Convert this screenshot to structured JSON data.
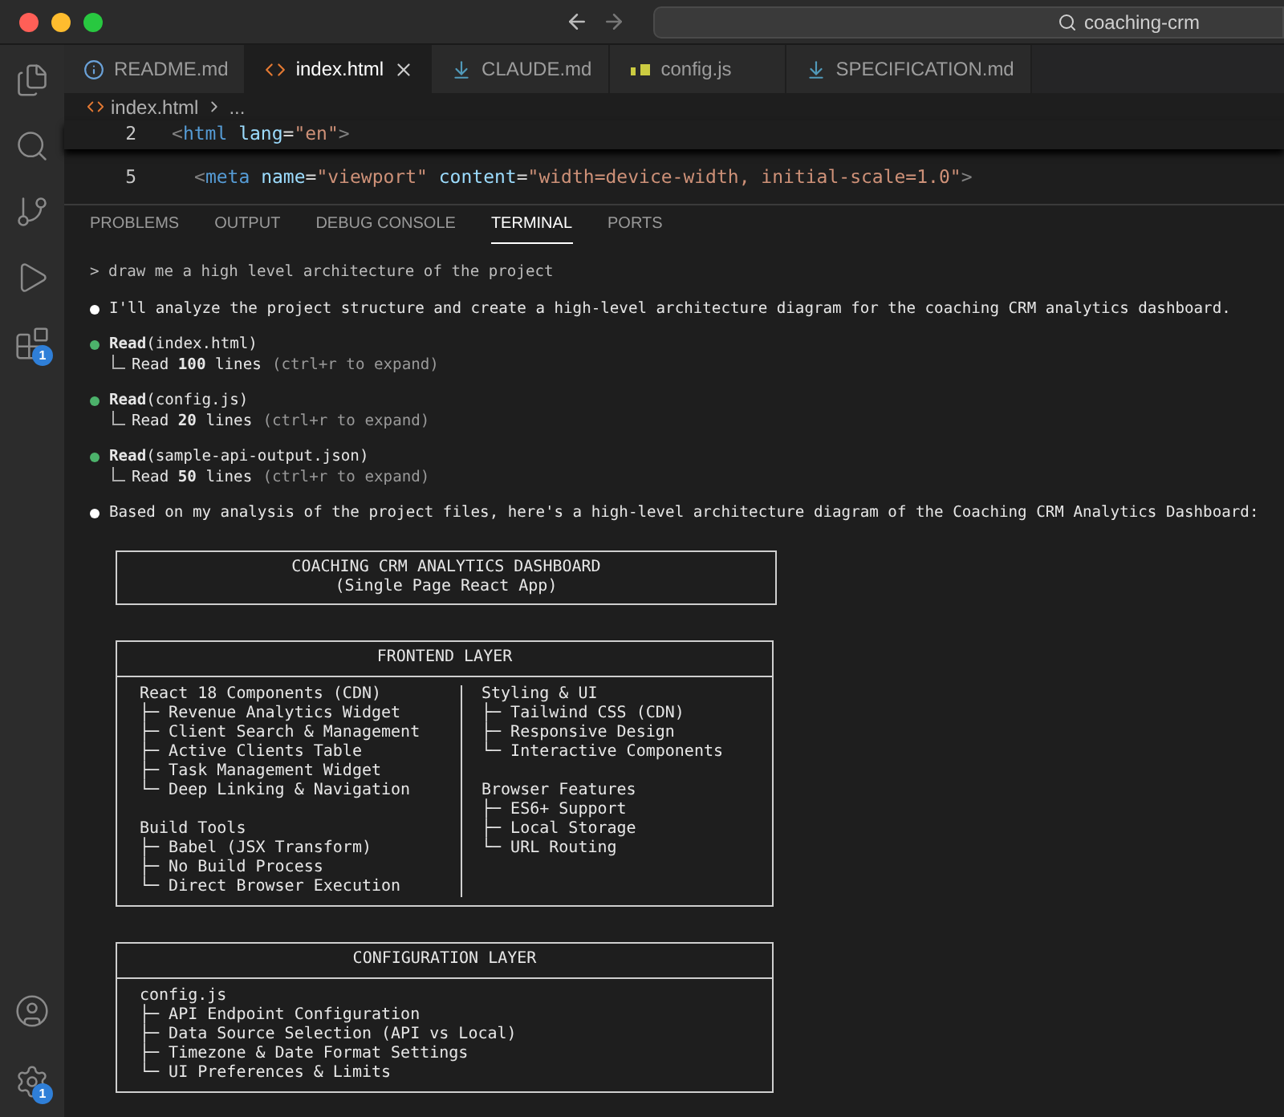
{
  "window": {
    "search": "coaching-crm"
  },
  "activity_bar": [
    {
      "kind": "files"
    },
    {
      "kind": "search"
    },
    {
      "kind": "source-control"
    },
    {
      "kind": "run-debug"
    },
    {
      "kind": "extensions",
      "badge": "1"
    }
  ],
  "activity_bar_bottom": [
    {
      "kind": "account"
    },
    {
      "kind": "settings",
      "badge": "1"
    }
  ],
  "tabs": [
    {
      "label": "README.md",
      "kind": "info",
      "selected": false
    },
    {
      "label": "index.html",
      "kind": "html",
      "selected": true
    },
    {
      "label": "CLAUDE.md",
      "kind": "markdown",
      "selected": false
    },
    {
      "label": "config.js",
      "kind": "js",
      "selected": false
    },
    {
      "label": "SPECIFICATION.md",
      "kind": "markdown",
      "selected": false
    }
  ],
  "breadcrumb": [
    "index.html",
    "..."
  ],
  "code_lines": [
    {
      "number": "2",
      "tokens": [
        {
          "kind": "bracket",
          "text": "<"
        },
        {
          "kind": "tag",
          "text": "html"
        },
        {
          "kind": "attr",
          "text": " lang"
        },
        {
          "kind": "plain",
          "text": "="
        },
        {
          "kind": "string",
          "text": "\"en\""
        },
        {
          "kind": "bracket",
          "text": ">"
        }
      ]
    },
    {
      "number": "5",
      "tokens": [
        {
          "kind": "bracket",
          "text": "<"
        },
        {
          "kind": "tag",
          "text": "meta"
        },
        {
          "kind": "attr",
          "text": " name"
        },
        {
          "kind": "plain",
          "text": "="
        },
        {
          "kind": "string",
          "text": "\"viewport\""
        },
        {
          "kind": "attr",
          "text": " content"
        },
        {
          "kind": "plain",
          "text": "="
        },
        {
          "kind": "string",
          "text": "\"width=device-width, initial-scale=1.0\""
        },
        {
          "kind": "bracket",
          "text": ">"
        }
      ]
    }
  ],
  "panel_tabs": [
    {
      "label": "PROBLEMS",
      "selected": false
    },
    {
      "label": "OUTPUT",
      "selected": false
    },
    {
      "label": "DEBUG CONSOLE",
      "selected": false
    },
    {
      "label": "TERMINAL",
      "selected": true
    },
    {
      "label": "PORTS",
      "selected": false
    }
  ],
  "terminal": [
    {
      "kind": "prompt",
      "text": "> draw me a high level architecture of the project"
    },
    {
      "kind": "message",
      "text": "I'll analyze the project structure and create a high-level architecture diagram for the coaching CRM analytics dashboard."
    },
    {
      "kind": "tool",
      "name": "Read",
      "args": "(index.html)",
      "result": "Read **100** lines",
      "hint": "(ctrl+r to expand)"
    },
    {
      "kind": "tool",
      "name": "Read",
      "args": "(config.js)",
      "result": "Read **20** lines",
      "hint": "(ctrl+r to expand)"
    },
    {
      "kind": "tool",
      "name": "Read",
      "args": "(sample-api-output.json)",
      "result": "Read **50** lines",
      "hint": "(ctrl+r to expand)"
    },
    {
      "kind": "message",
      "text": "Based on my analysis of the project files, here's a high-level architecture diagram of the Coaching CRM Analytics Dashboard:"
    }
  ],
  "diagram": [
    {
      "kind": "title",
      "lines": [
        "COACHING CRM ANALYTICS DASHBOARD",
        "(Single Page React App)"
      ]
    },
    {
      "kind": "layer",
      "heading": "FRONTEND LAYER",
      "columns": [
        [
          {
            "heading": "React 18 Components (CDN)",
            "items": [
              "├─ Revenue Analytics Widget",
              "├─ Client Search & Management",
              "├─ Active Clients Table",
              "├─ Task Management Widget",
              "└─ Deep Linking & Navigation"
            ]
          },
          {
            "heading": "Build Tools",
            "items": [
              "├─ Babel (JSX Transform)",
              "├─ No Build Process",
              "└─ Direct Browser Execution"
            ]
          }
        ],
        [
          {
            "heading": "Styling & UI",
            "items": [
              "├─ Tailwind CSS (CDN)",
              "├─ Responsive Design",
              "└─ Interactive Components"
            ]
          },
          {
            "heading": "Browser Features",
            "items": [
              "├─ ES6+ Support",
              "├─ Local Storage",
              "└─ URL Routing"
            ]
          }
        ]
      ]
    },
    {
      "kind": "layer",
      "heading": "CONFIGURATION LAYER",
      "columns": [
        [
          {
            "heading": "config.js",
            "items": [
              "├─ API Endpoint Configuration",
              "├─ Data Source Selection (API vs Local)",
              "├─ Timezone & Date Format Settings",
              "└─ UI Preferences & Limits"
            ]
          }
        ]
      ]
    }
  ]
}
